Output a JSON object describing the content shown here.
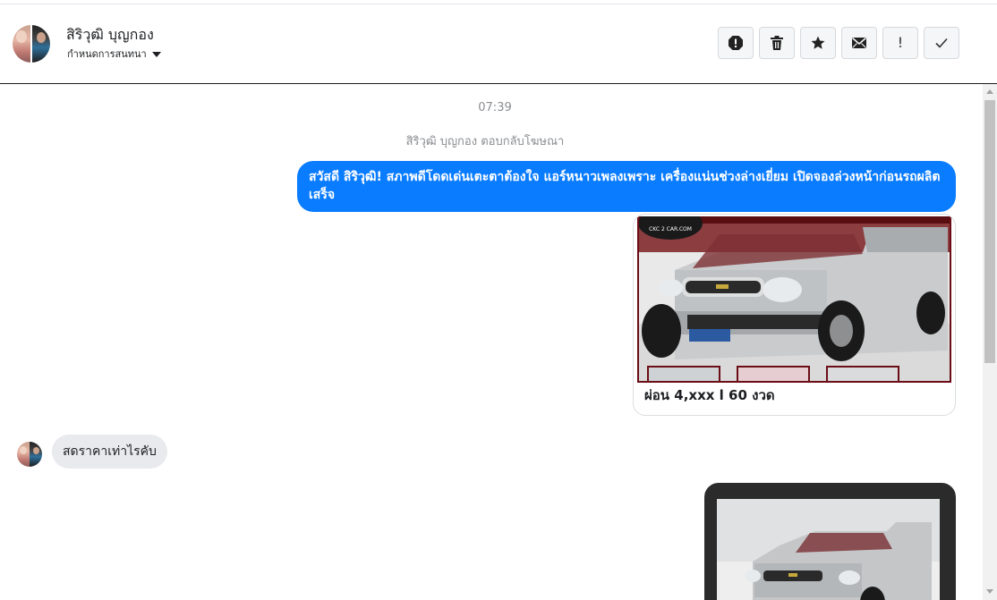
{
  "header": {
    "contact_name": "สิริวุฒิ บุญกอง",
    "assign_label": "กำหนดการสนทนา",
    "toolbar": [
      {
        "name": "spam-button",
        "icon": "alert-circle-icon"
      },
      {
        "name": "delete-button",
        "icon": "trash-icon"
      },
      {
        "name": "star-button",
        "icon": "star-icon"
      },
      {
        "name": "mark-unread-button",
        "icon": "envelope-icon"
      },
      {
        "name": "priority-button",
        "icon": "exclamation-icon",
        "glyph": "!"
      },
      {
        "name": "done-button",
        "icon": "checkmark-icon"
      }
    ]
  },
  "conversation": {
    "timestamp": "07:39",
    "system_message": "สิริวุฒิ บุญกอง ตอบกลับโฆษณา",
    "outgoing_text": "สวัสดี สิริวุฒิ! สภาพดีโดดเด่นเตะตาต้องใจ แอร์หนาวเพลงเพราะ เครื่องแน่นช่วงล่างเยี่ยม เปิดจองล่วงหน้าก่อนรถผลิตเสร็จ",
    "card1_caption": "ผ่อน 4,xxx l 60 งวด",
    "card1_logo_text": "CKC 2 CAR.COM",
    "incoming_text": "สดราคาเท่าไรคับ"
  },
  "colors": {
    "outgoing_bubble": "#0a7cff",
    "incoming_bubble": "#e9eaed",
    "card_frame": "#6b0d15"
  }
}
